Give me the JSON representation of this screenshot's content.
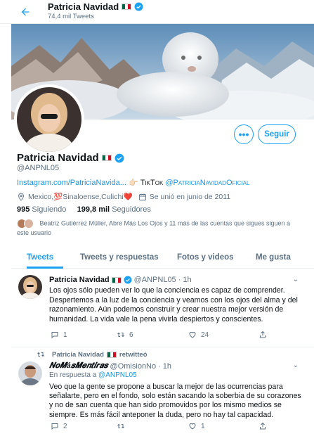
{
  "topbar": {
    "name": "Patricia Navidad",
    "tweet_count": "74,4 mil Tweets"
  },
  "profile": {
    "name": "Patricia Navidad",
    "handle": "@ANPNL05",
    "bio_link": "Instagram.com/PatriciaNavida...",
    "bio_tiktok_label": "TikTok",
    "bio_tiktok_handle": "@PatriciaNavidadOficial",
    "location": "Mexico,💯Sinaloense,Culichi❤️",
    "joined": "Se unió en junio de 2011",
    "following_count": "995",
    "following_label": "Siguiendo",
    "followers_count": "199,8 mil",
    "followers_label": "Seguidores",
    "known_followers": "Beatriz Gutiérrez Müller, Abre Más Los Ojos y 11 más de las cuentas que sigues siguen a este usuario",
    "follow_label": "Seguir",
    "more_label": "•••"
  },
  "tabs": [
    {
      "label": "Tweets",
      "active": true
    },
    {
      "label": "Tweets y respuestas",
      "active": false
    },
    {
      "label": "Fotos y videos",
      "active": false
    },
    {
      "label": "Me gusta",
      "active": false
    }
  ],
  "tweets": [
    {
      "author": "Patricia Navidad",
      "handle": "@ANPNL05",
      "time": "1h",
      "text": "Los ojos sólo pueden ver lo que la conciencia es capaz de comprender. Despertemos a la luz de la conciencia y veamos con los ojos del alma y del razonamiento. Aún podemos construir y crear nuestra mejor versión de humanidad. La vida vale la pena vivirla despiertos y conscientes.",
      "replies": "1",
      "retweets": "6",
      "likes": "24"
    },
    {
      "retweeted_by": "Patricia Navidad",
      "retweeted_label": "retwitteó",
      "author": "𝑵𝒐𝑴á𝒔𝑴𝒆𝒏𝒕𝒊𝒓𝒂𝒔",
      "handle": "@OmisionNo",
      "time": "1h",
      "reply_prefix": "En respuesta a",
      "reply_to": "@ANPNL05",
      "text": "Veo que la gente se propone a buscar la mejor de las ocurrencias para señalarte, pero en el fondo, solo están sacando la soberbia de su corazones y no de san cuenta que han sido promovidos por los mismo medios se siempre. Es más fácil anteponer la duda, pero no hay tal capacidad.",
      "replies": "2",
      "retweets": "",
      "likes": "1"
    }
  ],
  "colors": {
    "accent": "#1da1f2",
    "muted": "#5b7083",
    "text": "#0f1419"
  }
}
